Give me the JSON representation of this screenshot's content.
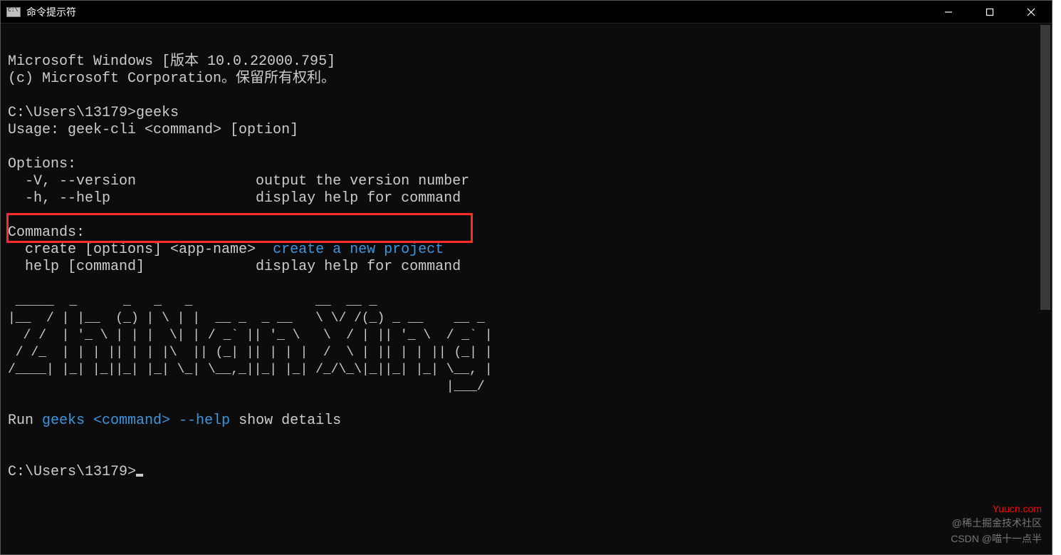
{
  "window": {
    "title": "命令提示符"
  },
  "terminal": {
    "line1": "Microsoft Windows [版本 10.0.22000.795]",
    "line2": "(c) Microsoft Corporation。保留所有权利。",
    "prompt1_path": "C:\\Users\\13179>",
    "prompt1_cmd": "geeks",
    "usage": "Usage: geek-cli <command> [option]",
    "options_header": "Options:",
    "opt_version": "  -V, --version              output the version number",
    "opt_help": "  -h, --help                 display help for command",
    "commands_header": "Commands:",
    "cmd_create_left": "  create [options] <app-name>  ",
    "cmd_create_desc": "create a new project",
    "cmd_help": "  help [command]             display help for command",
    "run_prefix": "Run ",
    "run_cyan1": "geeks <command> --help",
    "run_suffix": " show details",
    "prompt2_path": "C:\\Users\\13179>",
    "ascii_art": " _____  _      _   _   _                __  __ _             \n|__  / | |__  (_) | \\ | |  __ _  _ __   \\ \\/ /(_) _ __    __ _ \n  / /  | '_ \\ | | |  \\| | / _` || '_ \\   \\  / | || '_ \\  / _` |\n / /_  | | | || | | |\\  || (_| || | | |  /  \\ | || | | || (_| |\n/____| |_| |_||_| |_| \\_| \\__,_||_| |_| /_/\\_\\|_||_| |_| \\__, |\n                                                         |___/ "
  },
  "watermarks": {
    "yuucn": "Yuucn.com",
    "juejin": "@稀土掘金技术社区",
    "csdn": "CSDN @喵十一点半"
  }
}
